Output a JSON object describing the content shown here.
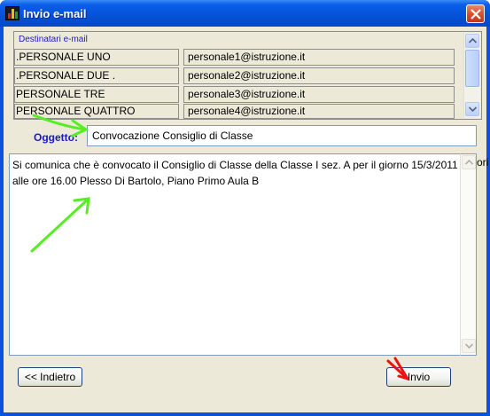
{
  "window": {
    "title": "Invio e-mail"
  },
  "recipients": {
    "label": "Destinatari e-mail",
    "rows": [
      {
        "name": ".PERSONALE UNO",
        "email": "personale1@istruzione.it"
      },
      {
        "name": ".PERSONALE DUE   .",
        "email": "personale2@istruzione.it"
      },
      {
        "name": "PERSONALE TRE",
        "email": "personale3@istruzione.it"
      },
      {
        "name": "PERSONALE QUATTRO",
        "email": " personale4@istruzione.it"
      }
    ]
  },
  "subject": {
    "label": "Oggetto:",
    "value": "Convocazione Consiglio di Classe"
  },
  "message": {
    "text": "Si comunica che è convocato il Consiglio di Classe della Classe I sez. A per il giorno 15/3/2011 alle ore 16.00 Plesso Di Bartolo, Piano Primo Aula B"
  },
  "side_text": "ori",
  "buttons": {
    "back": "<< Indietro",
    "send": "Invio"
  },
  "colors": {
    "title_blue": "#0553d8",
    "label_blue": "#1b1bbd",
    "arrow_green": "#55ee22",
    "arrow_red": "#ee1111"
  }
}
